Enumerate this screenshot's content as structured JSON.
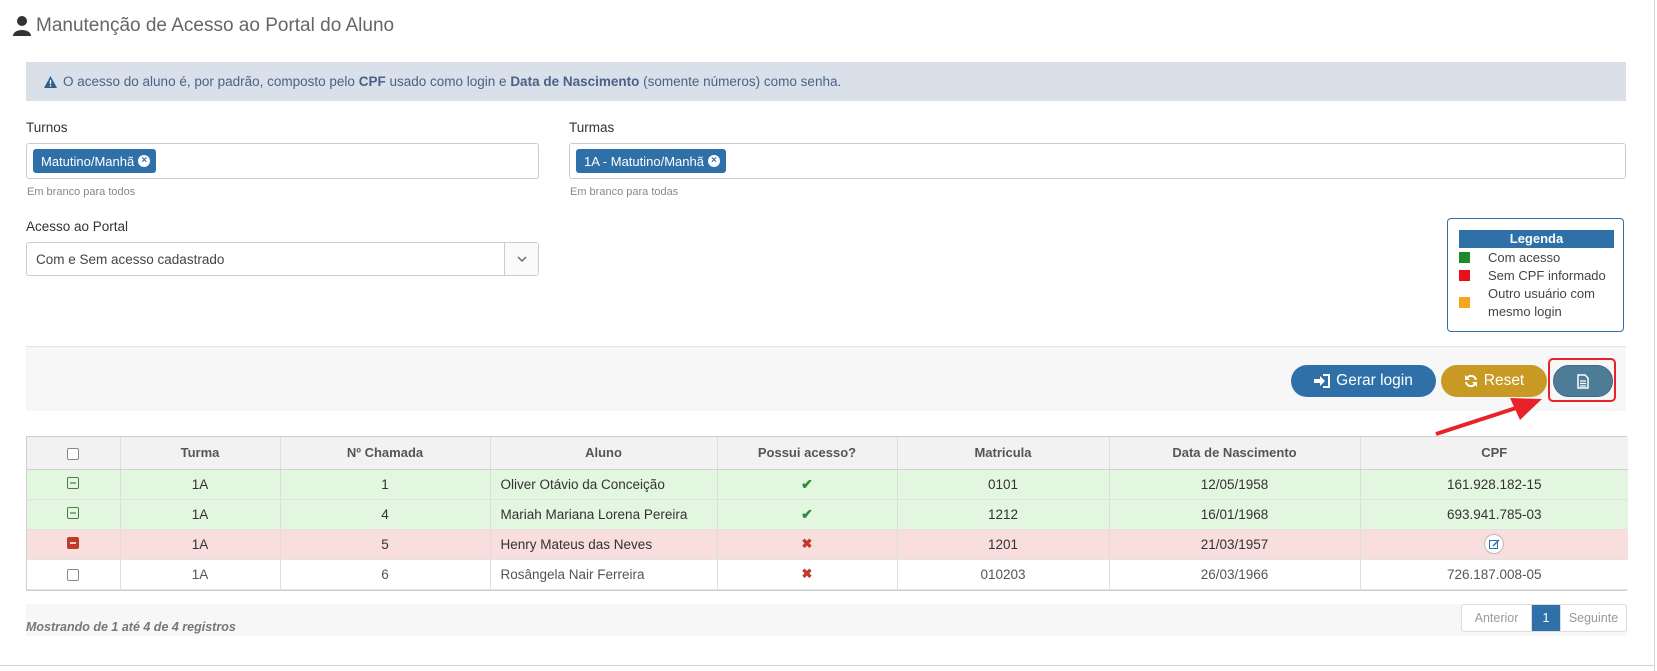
{
  "page": {
    "title": "Manutenção de Acesso ao Portal do Aluno"
  },
  "alert": {
    "pre": "O acesso do aluno é, por padrão, composto pelo",
    "cpf": "CPF",
    "mid": "usado como login e",
    "dn": "Data de Nascimento",
    "post": "(somente números) como senha."
  },
  "filters": {
    "turnos": {
      "label": "Turnos",
      "tag": "Matutino/Manhã",
      "help": "Em branco para todos"
    },
    "turmas": {
      "label": "Turmas",
      "tag": "1A - Matutino/Manhã",
      "help": "Em branco para todas"
    },
    "acesso": {
      "label": "Acesso ao Portal",
      "value": "Com e Sem acesso cadastrado"
    }
  },
  "legend": {
    "title": "Legenda",
    "items": [
      {
        "color": "#1e8a2c",
        "label": "Com acesso"
      },
      {
        "color": "#e8101b",
        "label": "Sem CPF informado"
      },
      {
        "color": "#f5a51e",
        "label": "Outro usuário com mesmo login"
      }
    ]
  },
  "actions": {
    "gerar_login": "Gerar login",
    "reset": "Reset"
  },
  "table": {
    "columns": [
      "Turma",
      "Nº Chamada",
      "Aluno",
      "Possui acesso?",
      "Matricula",
      "Data de Nascimento",
      "CPF"
    ],
    "rows": [
      {
        "turma": "1A",
        "chamada": "1",
        "aluno": "Oliver Otávio da Conceição",
        "matricula": "0101",
        "nascimento": "12/05/1958",
        "cpf": "161.928.182-15"
      },
      {
        "turma": "1A",
        "chamada": "4",
        "aluno": "Mariah Mariana Lorena Pereira",
        "matricula": "1212",
        "nascimento": "16/01/1968",
        "cpf": "693.941.785-03"
      },
      {
        "turma": "1A",
        "chamada": "5",
        "aluno": "Henry Mateus das Neves",
        "matricula": "1201",
        "nascimento": "21/03/1957",
        "cpf": ""
      },
      {
        "turma": "1A",
        "chamada": "6",
        "aluno": "Rosângela Nair Ferreira",
        "matricula": "010203",
        "nascimento": "26/03/1966",
        "cpf": "726.187.008-05"
      }
    ],
    "info": "Mostrando de 1 até 4 de 4 registros"
  },
  "pagination": {
    "prev": "Anterior",
    "current": "1",
    "next": "Seguinte"
  }
}
